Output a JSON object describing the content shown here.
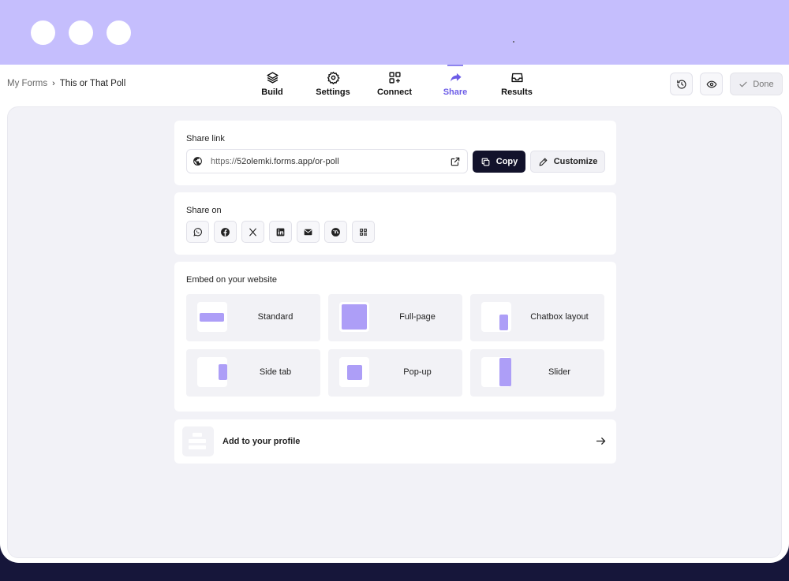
{
  "breadcrumb": {
    "root": "My Forms",
    "separator": "›",
    "current": "This or That Poll"
  },
  "nav": [
    {
      "label": "Build",
      "icon": "layers-icon"
    },
    {
      "label": "Settings",
      "icon": "gear-icon"
    },
    {
      "label": "Connect",
      "icon": "grid-plus-icon"
    },
    {
      "label": "Share",
      "icon": "share-arrow-icon",
      "active": true
    },
    {
      "label": "Results",
      "icon": "inbox-icon"
    }
  ],
  "actions": {
    "history_icon": "history-icon",
    "preview_icon": "eye-icon",
    "done_label": "Done"
  },
  "share_link": {
    "title": "Share link",
    "url_prefix": "https://",
    "url_rest": "52olemki.forms.app/or-poll",
    "copy_label": "Copy",
    "customize_label": "Customize"
  },
  "share_on": {
    "title": "Share on",
    "platforms": [
      "whatsapp-icon",
      "facebook-icon",
      "x-icon",
      "linkedin-icon",
      "email-icon",
      "wordpress-icon",
      "qr-code-icon"
    ]
  },
  "embed": {
    "title": "Embed on your website",
    "options": [
      {
        "label": "Standard"
      },
      {
        "label": "Full-page"
      },
      {
        "label": "Chatbox layout"
      },
      {
        "label": "Side tab"
      },
      {
        "label": "Pop-up"
      },
      {
        "label": "Slider"
      }
    ]
  },
  "profile": {
    "label": "Add to your profile"
  },
  "colors": {
    "accent": "#6c5ce7",
    "titlebar": "#c5befd",
    "embed_shape": "#ad9ef7",
    "copy_bg": "#12122b"
  }
}
